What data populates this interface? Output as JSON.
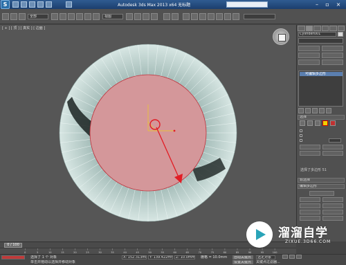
{
  "titlebar": {
    "title": "Autodesk 3ds Max  2013 x64    无标题",
    "search_placeholder": ""
  },
  "menubar": {
    "workspace_dropdown": "",
    "selection_filter": "全部",
    "view_dropdown": "视图"
  },
  "viewport": {
    "label": "[ + ] [ 顶 ] [ 真实 ] [ 边面 ]"
  },
  "command_panel": {
    "object_name": "Cylinder001",
    "modifier_list": "",
    "buttons": [
      "",
      "",
      "",
      "",
      "",
      ""
    ],
    "stack_item": "可编辑多边形",
    "selection_rollout": "选择",
    "soft_selection_rollout": "软选择",
    "edit_polygons_rollout": "编辑多边形",
    "selection_info": "选择了多边形 51",
    "insert_vertex": "",
    "edit_buttons": [
      "",
      "",
      "",
      "",
      "",
      "",
      "",
      ""
    ]
  },
  "timeline": {
    "frame": "0 / 100",
    "ticks": [
      "0",
      "5",
      "10",
      "15",
      "20",
      "25",
      "30",
      "35",
      "40",
      "45",
      "50",
      "55",
      "60",
      "65",
      "70",
      "75",
      "80",
      "85",
      "90",
      "95",
      "100"
    ]
  },
  "statusbar": {
    "sel_count": "选择了 1 个 对象",
    "prompt": "单击并拖动以选择并移动对象",
    "coord_x": "X: 152.313mm",
    "coord_y": "Y: 139.422mm",
    "coord_z": "Z: 10.0mm",
    "grid": "栅格 = 10.0mm",
    "autokey": "自动关键点",
    "setkey": "设置关键点",
    "selected": "选定对象",
    "key_filter": "关键点过滤器..."
  },
  "watermark": {
    "title": "溜溜自学",
    "url": "ZIXUE.3D66.COM"
  },
  "colors": {
    "selected_face": "#d4979a",
    "ring_light": "#c2d8d4",
    "gizmo_yellow": "#e8c23a",
    "gizmo_red": "#e21c24"
  }
}
